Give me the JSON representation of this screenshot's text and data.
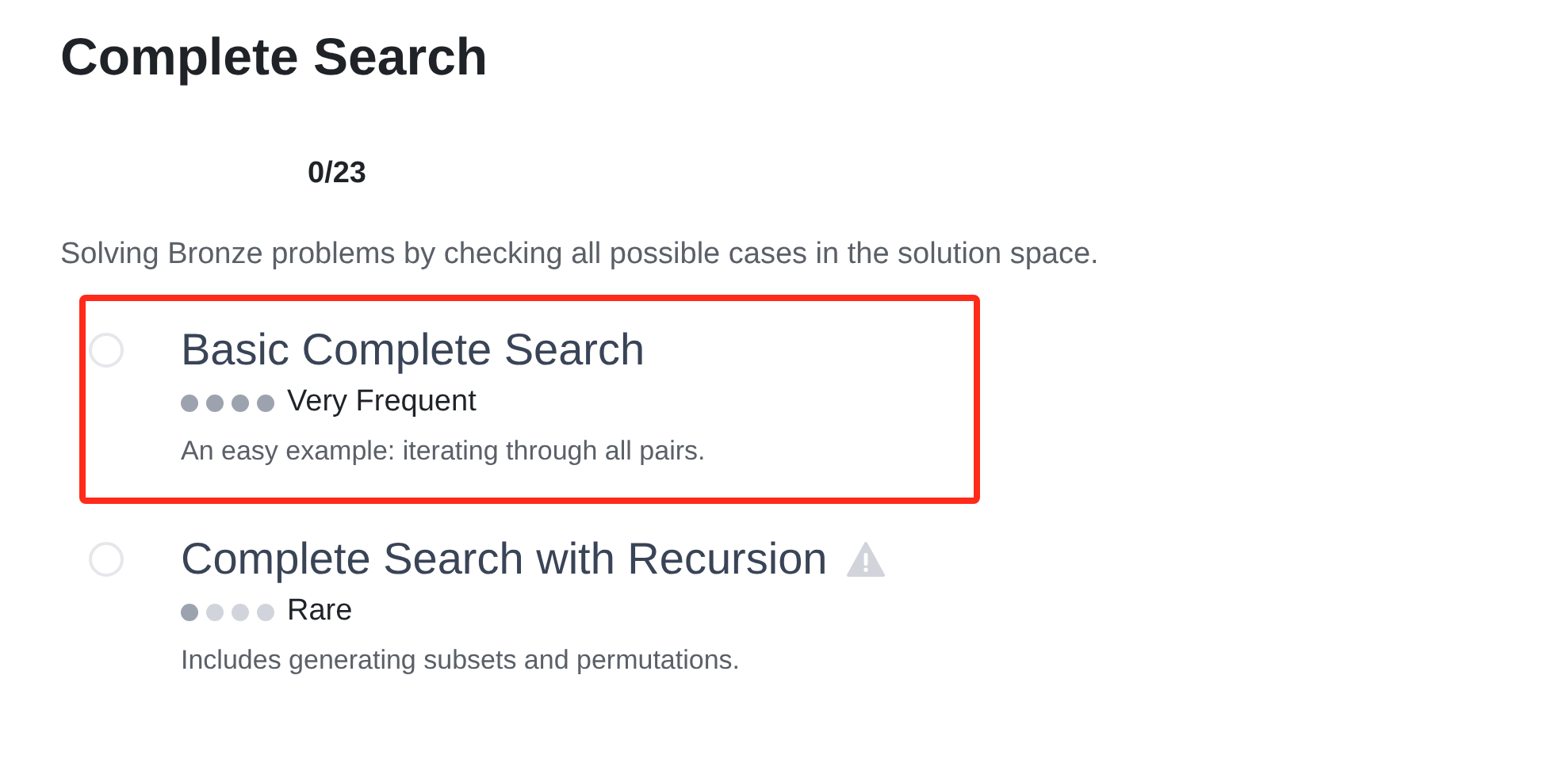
{
  "section": {
    "title": "Complete Search",
    "progress": "0/23",
    "description": "Solving Bronze problems by checking all possible cases in the solution space."
  },
  "modules": [
    {
      "title": "Basic Complete Search",
      "stars": 4,
      "frequency": "Very Frequent",
      "summary": "An easy example: iterating through all pairs.",
      "completed": false,
      "warning": false,
      "highlighted": true
    },
    {
      "title": "Complete Search with Recursion",
      "stars": 1,
      "frequency": "Rare",
      "summary": "Includes generating subsets and permutations.",
      "completed": false,
      "warning": true,
      "highlighted": false
    }
  ]
}
